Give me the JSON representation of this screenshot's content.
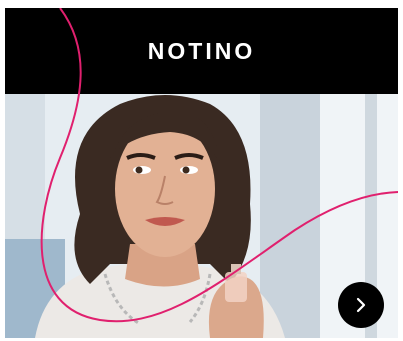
{
  "ad": {
    "brand": "NOTINO",
    "next_button_icon": "chevron-right-icon",
    "colors": {
      "header_bg": "#000000",
      "logo_text": "#ffffff",
      "accent_curve": "#e0206e",
      "button_bg": "#000000"
    }
  }
}
